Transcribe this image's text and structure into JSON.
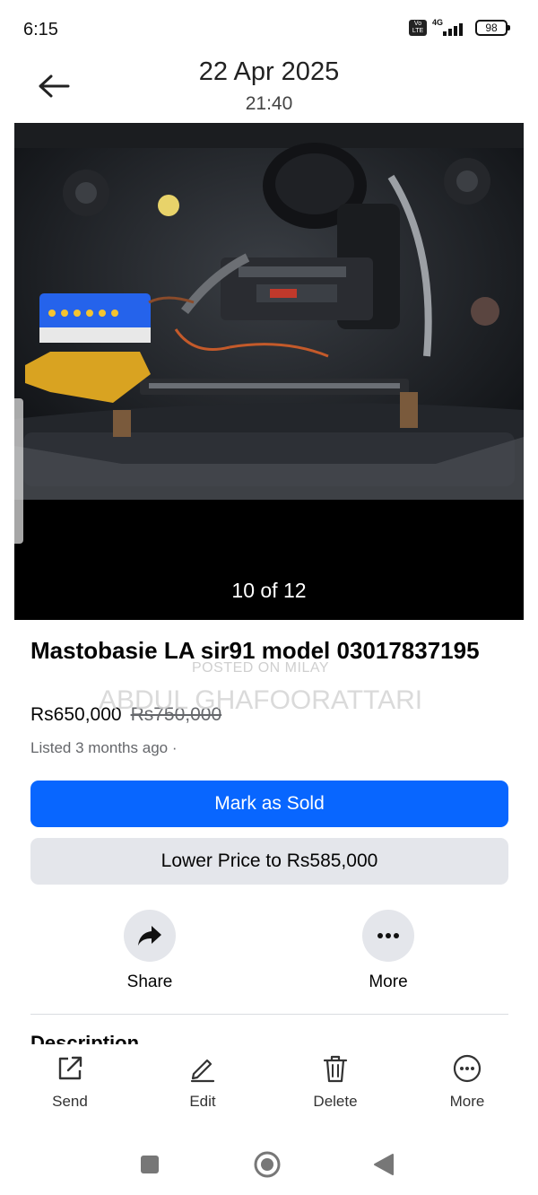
{
  "status_bar": {
    "time": "6:15",
    "volte": "Vo LTE",
    "network": "4G",
    "battery": "98"
  },
  "header": {
    "date": "22 Apr 2025",
    "time": "21:40",
    "back_icon": "arrow-left-icon"
  },
  "photo": {
    "counter": "10 of 12"
  },
  "listing": {
    "title": "Mastobasie LA sir91 model 03017837195",
    "price": "Rs650,000",
    "original_price": "Rs750,000",
    "listed": "Listed 3 months ago ·"
  },
  "watermark": {
    "line1": "POSTED ON MILAY",
    "line2": "ABDUL GHAFOORATTARI"
  },
  "buttons": {
    "mark_sold": "Mark as Sold",
    "lower_price": "Lower Price to Rs585,000"
  },
  "actions": [
    {
      "label": "Share",
      "icon": "share-icon"
    },
    {
      "label": "More",
      "icon": "more-icon"
    }
  ],
  "description_heading": "Description",
  "toolbar": [
    {
      "label": "Send",
      "icon": "send-icon"
    },
    {
      "label": "Edit",
      "icon": "edit-icon"
    },
    {
      "label": "Delete",
      "icon": "delete-icon"
    },
    {
      "label": "More",
      "icon": "more-icon"
    }
  ],
  "colors": {
    "primary": "#0866ff",
    "secondary_bg": "#e4e6eb",
    "muted_text": "#65676b"
  }
}
